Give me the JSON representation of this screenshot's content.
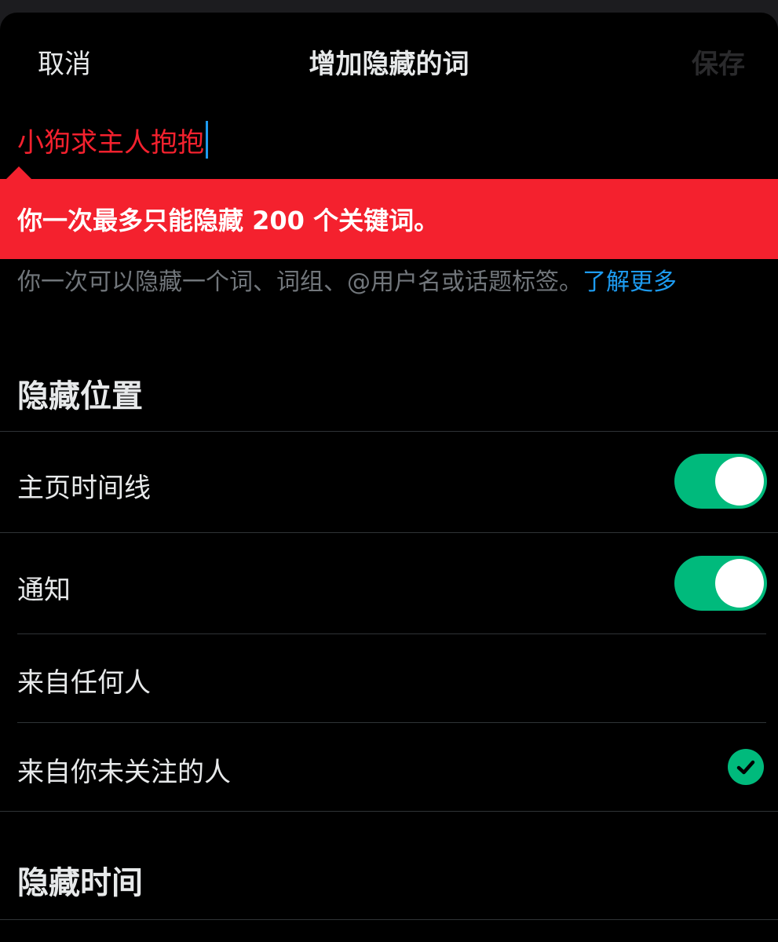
{
  "nav": {
    "cancel_label": "取消",
    "title": "增加隐藏的词",
    "save_label": "保存"
  },
  "input": {
    "value": "小狗求主人抱抱"
  },
  "error": {
    "message": "你一次最多只能隐藏 200 个关键词。"
  },
  "help": {
    "text": "你一次可以隐藏一个词、词组、@用户名或话题标签。",
    "link_label": "了解更多"
  },
  "mute_from": {
    "title": "隐藏位置",
    "items": [
      {
        "label": "主页时间线",
        "enabled": true
      },
      {
        "label": "通知",
        "enabled": true
      }
    ]
  },
  "audience": {
    "items": [
      {
        "label": "来自任何人",
        "selected": false
      },
      {
        "label": "来自你未关注的人",
        "selected": true
      }
    ]
  },
  "duration": {
    "title": "隐藏时间"
  },
  "colors": {
    "background": "#000000",
    "accent_green": "#00ba7c",
    "error_red": "#f4212e",
    "link_blue": "#1d9bf0",
    "muted_text": "#71767b"
  },
  "icons": {
    "caret": "text-caret-icon",
    "check": "checkmark-icon"
  }
}
